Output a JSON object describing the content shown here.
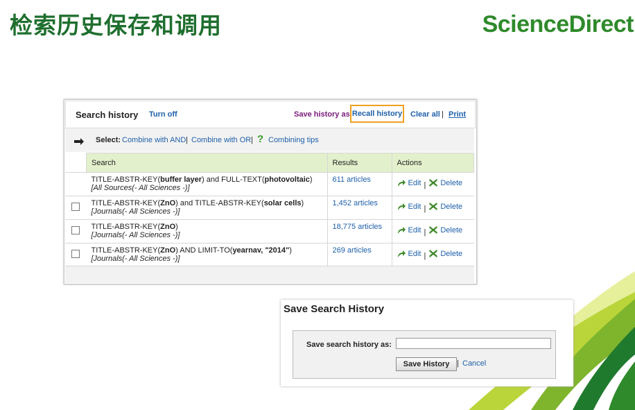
{
  "slide": {
    "title": "检索历史保存和调用",
    "brand": "ScienceDirect"
  },
  "search_history": {
    "title": "Search history",
    "turn_off": "Turn off",
    "save_history_as": "Save history as",
    "recall_history": "Recall history",
    "clear_all": "Clear all",
    "print": "Print",
    "separator": "|",
    "select_label": "Select:",
    "combine_and": "Combine with AND",
    "combine_or": "Combine with OR",
    "combining_tips": "Combining tips",
    "columns": {
      "search": "Search",
      "results": "Results",
      "actions": "Actions"
    },
    "edit_label": "Edit",
    "delete_label": "Delete",
    "rows": [
      {
        "has_checkbox": false,
        "q1": "TITLE-ABSTR-KEY(",
        "b1": "buffer layer",
        "q2": ") and FULL-TEXT(",
        "b2": "photovoltaic",
        "q3": ")",
        "source": "[All Sources(- All Sciences -)]",
        "results": "611 articles"
      },
      {
        "has_checkbox": true,
        "q1": "TITLE-ABSTR-KEY(",
        "b1": "ZnO",
        "q2": ") and TITLE-ABSTR-KEY(",
        "b2": "solar cells",
        "q3": ")",
        "source": "[Journals(- All Sciences -)]",
        "results": "1,452 articles"
      },
      {
        "has_checkbox": true,
        "q1": "TITLE-ABSTR-KEY(",
        "b1": "ZnO",
        "q2": ")",
        "b2": "",
        "q3": "",
        "source": "[Journals(- All Sciences -)]",
        "results": "18,775 articles"
      },
      {
        "has_checkbox": true,
        "q1": "TITLE-ABSTR-KEY(",
        "b1": "ZnO",
        "q2": ") AND LIMIT-TO(",
        "b2": "yearnav, \"2014\"",
        "q3": ")",
        "source": "[Journals(- All Sciences -)]",
        "results": "269 articles"
      }
    ]
  },
  "save_dialog": {
    "title": "Save Search History",
    "label": "Save search history as:",
    "input_value": "",
    "save_button": "Save History",
    "separator": "|",
    "cancel": "Cancel"
  },
  "colors": {
    "title_green": "#1f6f2f",
    "brand_green": "#2f8a2b",
    "link_blue": "#1d5fa8",
    "highlight_orange": "#f0a020",
    "header_green": "#e3f0cc"
  }
}
